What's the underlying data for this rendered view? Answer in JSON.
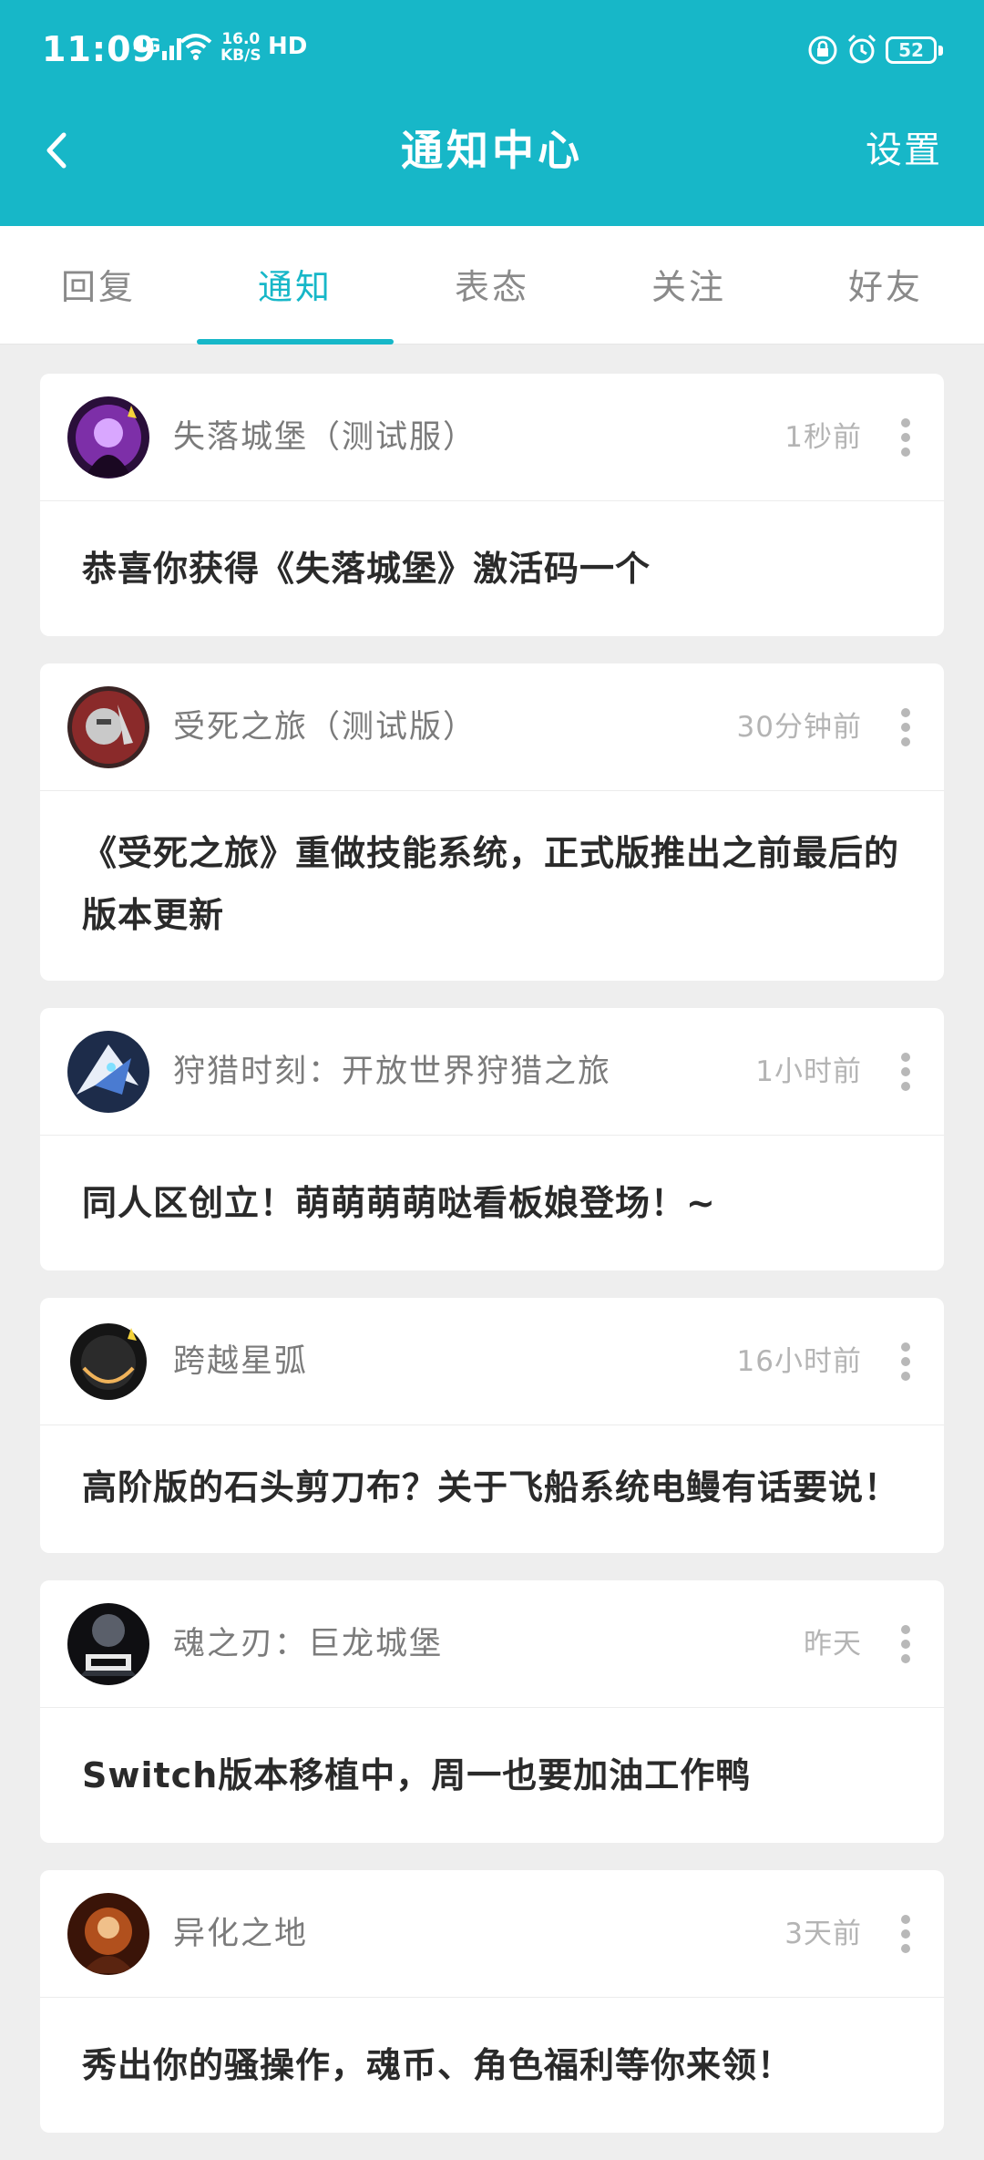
{
  "status_bar": {
    "time": "11:09",
    "network": "4G",
    "speed_value": "16.0",
    "speed_unit": "KB/S",
    "hd": "HD",
    "battery": "52"
  },
  "header": {
    "title": "通知中心",
    "settings_label": "设置",
    "background_color": "#17b7c8"
  },
  "tabs": [
    {
      "label": "回复",
      "active": false
    },
    {
      "label": "通知",
      "active": true
    },
    {
      "label": "表态",
      "active": false
    },
    {
      "label": "关注",
      "active": false
    },
    {
      "label": "好友",
      "active": false
    }
  ],
  "notifications": [
    {
      "game": "失落城堡（测试服）",
      "time": "1秒前",
      "message": "恭喜你获得《失落城堡》激活码一个",
      "avatar": "lost-castle-avatar"
    },
    {
      "game": "受死之旅（测试版）",
      "time": "30分钟前",
      "message": "《受死之旅》重做技能系统，正式版推出之前最后的版本更新",
      "avatar": "death-journey-avatar"
    },
    {
      "game": "狩猎时刻：开放世界狩猎之旅",
      "time": "1小时前",
      "message": "同人区创立！萌萌萌萌哒看板娘登场！~",
      "avatar": "hunting-moment-avatar"
    },
    {
      "game": "跨越星弧",
      "time": "16小时前",
      "message": "高阶版的石头剪刀布？关于飞船系统电鳗有话要说！",
      "avatar": "star-arc-avatar"
    },
    {
      "game": "魂之刃：巨龙城堡",
      "time": "昨天",
      "message": "Switch版本移植中，周一也要加油工作鸭",
      "avatar": "soul-blade-avatar"
    },
    {
      "game": "异化之地",
      "time": "3天前",
      "message": "秀出你的骚操作，魂币、角色福利等你来领！",
      "avatar": "alien-land-avatar"
    }
  ]
}
